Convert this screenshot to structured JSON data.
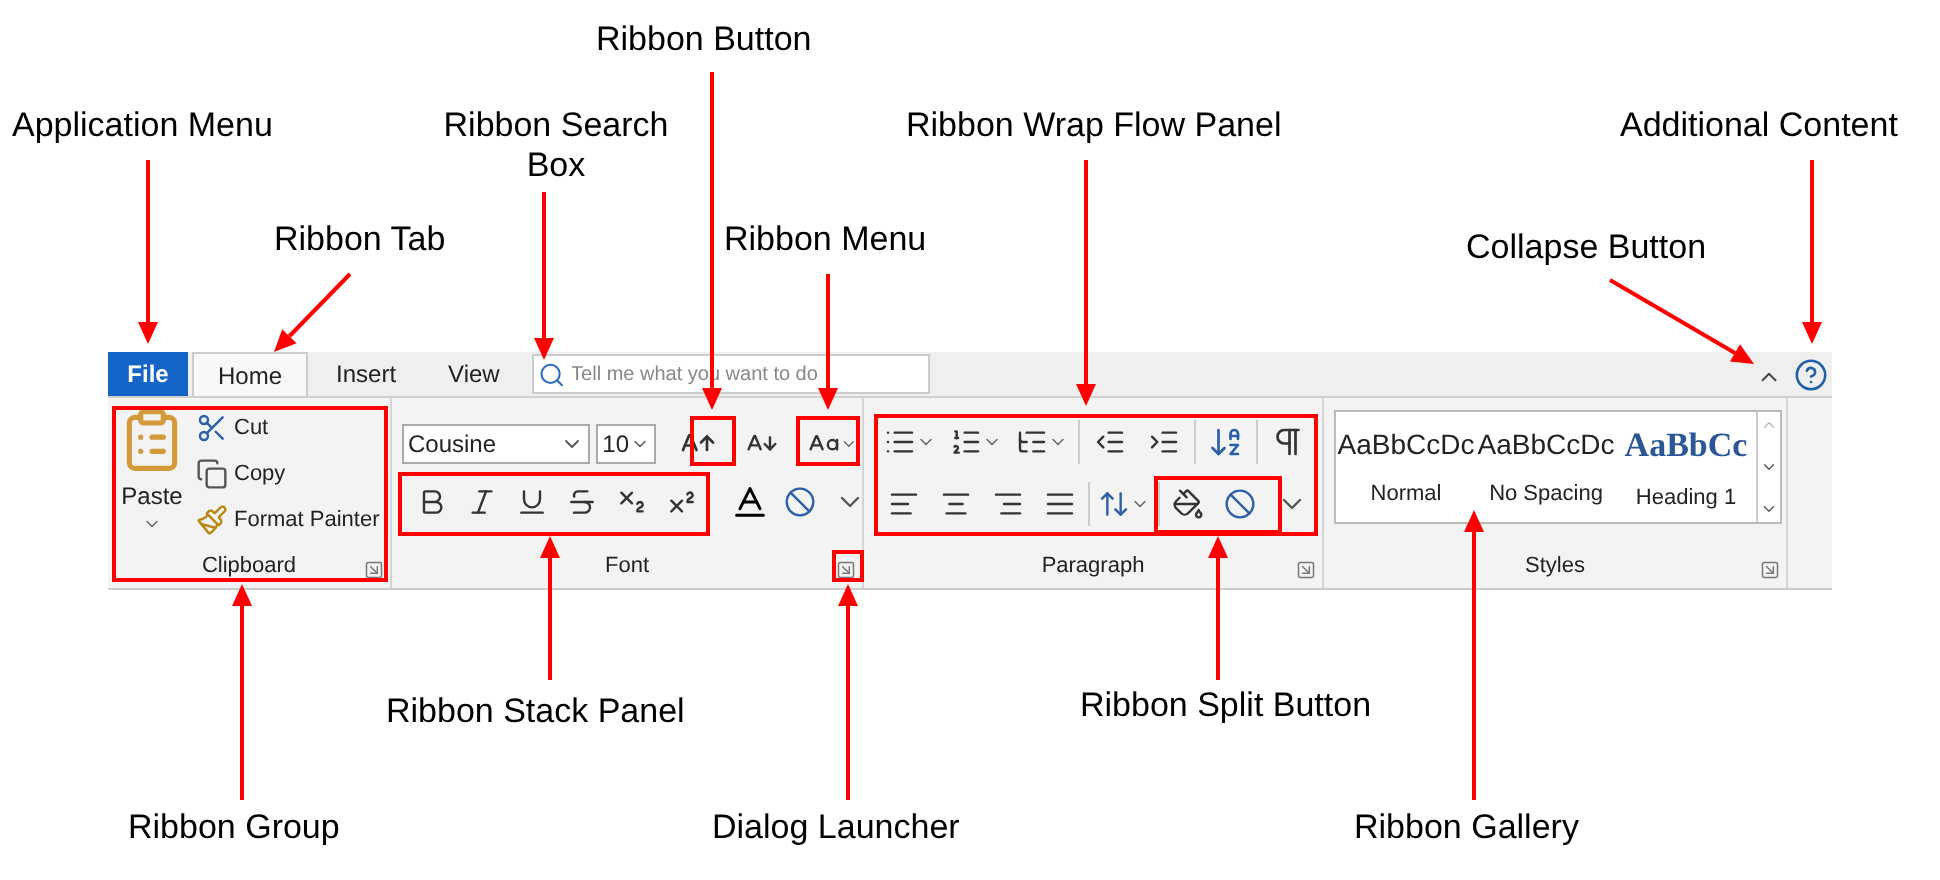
{
  "annotations": [
    {
      "label": "Ribbon Button"
    },
    {
      "label": "Application Menu"
    },
    {
      "label": "Ribbon Search Box"
    },
    {
      "label": "Ribbon Wrap Flow Panel"
    },
    {
      "label": "Additional Content"
    },
    {
      "label": "Ribbon Tab"
    },
    {
      "label": "Ribbon Menu"
    },
    {
      "label": "Collapse Button"
    },
    {
      "label": "Ribbon Stack Panel"
    },
    {
      "label": "Ribbon Split Button"
    },
    {
      "label": "Ribbon Group"
    },
    {
      "label": "Dialog Launcher"
    },
    {
      "label": "Ribbon Gallery"
    }
  ],
  "ribbon": {
    "file_menu": "File",
    "tabs": [
      {
        "label": "Home",
        "selected": true
      },
      {
        "label": "Insert",
        "selected": false
      },
      {
        "label": "View",
        "selected": false
      }
    ],
    "search": {
      "placeholder": "Tell me what you want to do"
    },
    "groups": [
      {
        "kind": "clipboard",
        "label": "Clipboard",
        "paste": "Paste",
        "commands": [
          "Cut",
          "Copy",
          "Format Painter"
        ]
      },
      {
        "kind": "font",
        "label": "Font",
        "font_name": "Cousine",
        "font_size": "10"
      },
      {
        "kind": "paragraph",
        "label": "Paragraph"
      },
      {
        "kind": "styles",
        "label": "Styles",
        "styles": [
          {
            "preview": "AaBbCcDc",
            "name": "Normal",
            "kind": "body"
          },
          {
            "preview": "AaBbCcDc",
            "name": "No Spacing",
            "kind": "body"
          },
          {
            "preview": "AaBbCc",
            "name": "Heading 1",
            "kind": "heading"
          }
        ]
      }
    ]
  }
}
